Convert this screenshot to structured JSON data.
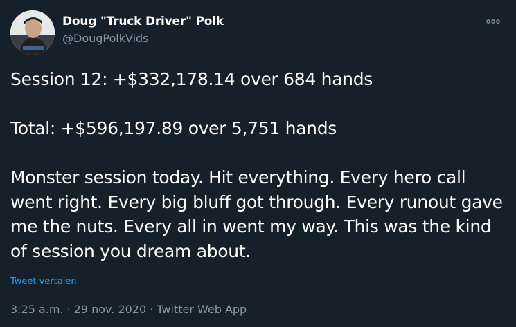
{
  "author": {
    "display_name": "Doug \"Truck Driver\" Polk",
    "handle": "@DougPolkVids",
    "avatar_icon": "profile-photo"
  },
  "menu": {
    "icon": "more-options-icon"
  },
  "tweet": {
    "paragraphs": [
      "Session 12: +$332,178.14 over 684 hands",
      "Total: +$596,197.89 over 5,751 hands",
      "Monster session today. Hit everything. Every hero call went right. Every big bluff got through. Every runout gave me the nuts. Every all in went my way. This was the kind of session you dream about."
    ],
    "translate_label": "Tweet vertalen"
  },
  "meta": {
    "time": "3:25 a.m.",
    "separator": "·",
    "date": "29 nov. 2020",
    "source": "Twitter Web App"
  },
  "colors": {
    "background": "#15202b",
    "text": "#ffffff",
    "secondary": "#8899a6",
    "link": "#1da1f2"
  }
}
